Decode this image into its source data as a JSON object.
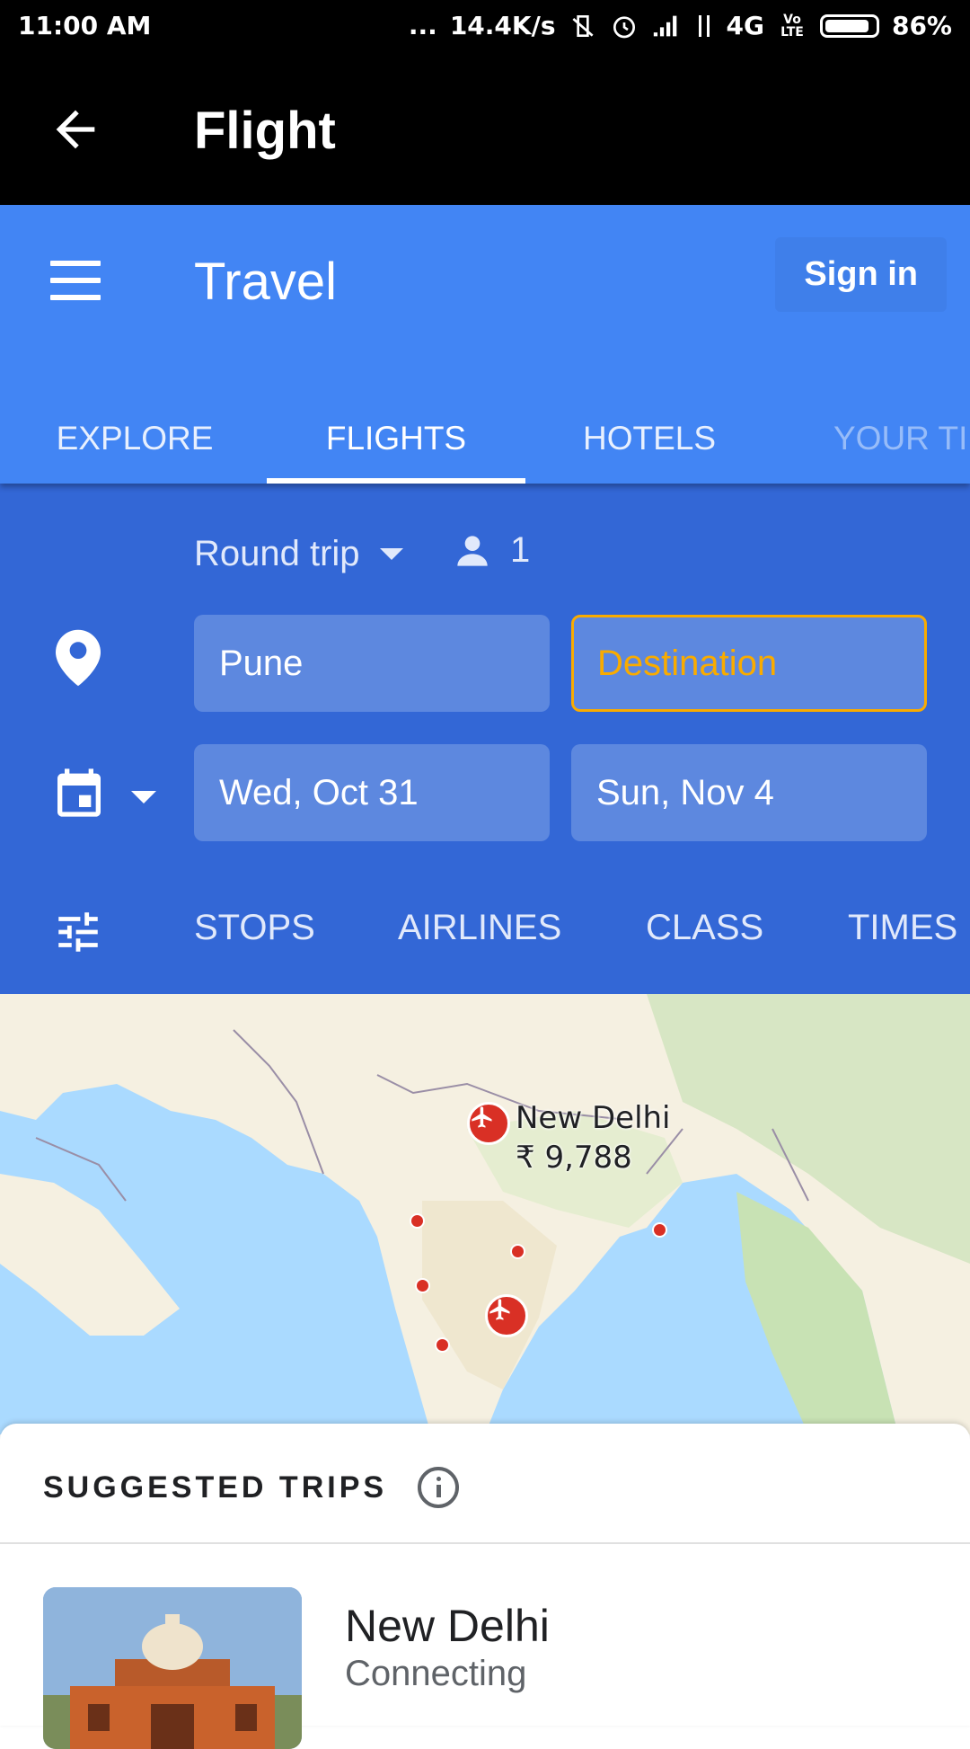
{
  "status_bar": {
    "time": "11:00 AM",
    "indicators": "...",
    "network_speed": "14.4K/s",
    "network_type": "4G",
    "volte": "Vo LTE",
    "battery": "86%"
  },
  "app_bar": {
    "title": "Flight",
    "back_icon": "arrow-left-icon"
  },
  "travel_header": {
    "title": "Travel",
    "sign_in": "Sign in",
    "menu_icon": "hamburger-menu-icon",
    "tabs": [
      {
        "label": "EXPLORE",
        "active": false
      },
      {
        "label": "FLIGHTS",
        "active": true
      },
      {
        "label": "HOTELS",
        "active": false
      },
      {
        "label": "YOUR TI",
        "active": false
      }
    ]
  },
  "search": {
    "trip_type": "Round trip",
    "passengers": "1",
    "origin": "Pune",
    "destination_placeholder": "Destination",
    "depart_date": "Wed, Oct 31",
    "return_date": "Sun, Nov 4",
    "filters": [
      "STOPS",
      "AIRLINES",
      "CLASS",
      "TIMES"
    ]
  },
  "map": {
    "city": "New Delhi",
    "price": "₹ 9,788"
  },
  "suggested": {
    "header": "SUGGESTED TRIPS",
    "trip": {
      "name": "New Delhi",
      "subtitle": "Connecting"
    }
  },
  "colors": {
    "header_blue": "#4285f4",
    "panel_blue": "#3367d6",
    "field_blue": "#5d88df",
    "destination_accent": "#f9ab00",
    "marker_red": "#d93025"
  }
}
